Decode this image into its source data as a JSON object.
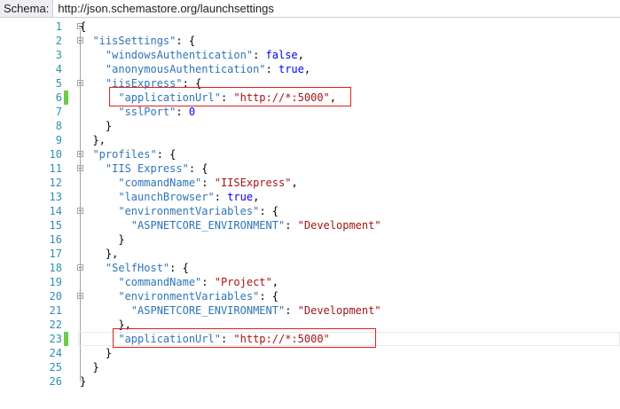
{
  "schema": {
    "label": "Schema:",
    "url": "http://json.schemastore.org/launchsettings"
  },
  "colors": {
    "change_marker": "#6ccd4a",
    "highlight_box": "#e02020",
    "key": "#2e75b6",
    "string": "#a31515",
    "keyword": "#0000ff",
    "line_number": "#2b91af"
  },
  "editor": {
    "lines": [
      {
        "num": "1",
        "text": "{"
      },
      {
        "num": "2",
        "text": "  \"iisSettings\": {"
      },
      {
        "num": "3",
        "text": "    \"windowsAuthentication\": false,"
      },
      {
        "num": "4",
        "text": "    \"anonymousAuthentication\": true,"
      },
      {
        "num": "5",
        "text": "    \"iisExpress\": {"
      },
      {
        "num": "6",
        "text": "      \"applicationUrl\": \"http://*:5000\","
      },
      {
        "num": "7",
        "text": "      \"sslPort\": 0"
      },
      {
        "num": "8",
        "text": "    }"
      },
      {
        "num": "9",
        "text": "  },"
      },
      {
        "num": "10",
        "text": "  \"profiles\": {"
      },
      {
        "num": "11",
        "text": "    \"IIS Express\": {"
      },
      {
        "num": "12",
        "text": "      \"commandName\": \"IISExpress\","
      },
      {
        "num": "13",
        "text": "      \"launchBrowser\": true,"
      },
      {
        "num": "14",
        "text": "      \"environmentVariables\": {"
      },
      {
        "num": "15",
        "text": "        \"ASPNETCORE_ENVIRONMENT\": \"Development\""
      },
      {
        "num": "16",
        "text": "      }"
      },
      {
        "num": "17",
        "text": "    },"
      },
      {
        "num": "18",
        "text": "    \"SelfHost\": {"
      },
      {
        "num": "19",
        "text": "      \"commandName\": \"Project\","
      },
      {
        "num": "20",
        "text": "      \"environmentVariables\": {"
      },
      {
        "num": "21",
        "text": "        \"ASPNETCORE_ENVIRONMENT\": \"Development\""
      },
      {
        "num": "22",
        "text": "      },"
      },
      {
        "num": "23",
        "text": "      \"applicationUrl\": \"http://*:5000\""
      },
      {
        "num": "24",
        "text": "    }"
      },
      {
        "num": "25",
        "text": "  }"
      },
      {
        "num": "26",
        "text": "}"
      }
    ]
  }
}
